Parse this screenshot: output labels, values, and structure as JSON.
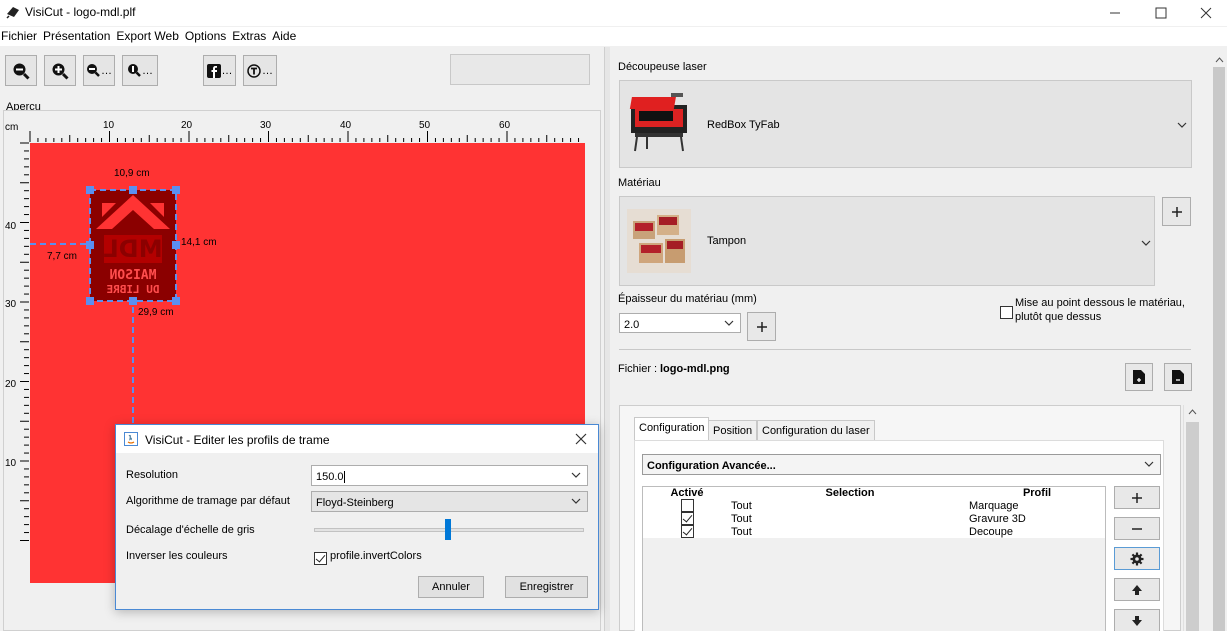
{
  "window": {
    "title": "VisiCut - logo-mdl.plf"
  },
  "menu": [
    "Fichier",
    "Présentation",
    "Export Web",
    "Options",
    "Extras",
    "Aide"
  ],
  "toolbar": {
    "more": "…"
  },
  "preview": {
    "label": "Aperçu",
    "unit": "cm",
    "top_ticks": [
      "10",
      "20",
      "30",
      "40",
      "50",
      "60"
    ],
    "left_ticks": [
      "40",
      "30",
      "20",
      "10"
    ],
    "width_label": "10,9 cm",
    "height_label": "14,1 cm",
    "left_label": "7,7 cm",
    "bottom_label": "29,9 cm",
    "logo_text_1": "MAISON",
    "logo_text_2": "DU LIBRE",
    "colors": {
      "bed": "#ff3333",
      "logo": "#8b0000",
      "handle": "#5b8ff0"
    }
  },
  "laser": {
    "label": "Découpeuse laser",
    "name": "RedBox TyFab"
  },
  "material": {
    "label": "Matériau",
    "name": "Tampon"
  },
  "thickness": {
    "label": "Épaisseur du matériau (mm)",
    "value": "2.0",
    "focus_line1": "Mise au point dessous le matériau,",
    "focus_line2": "plutôt que dessus"
  },
  "file": {
    "label": "Fichier :",
    "name": "logo-mdl.png"
  },
  "tabs": [
    "Configuration",
    "Position",
    "Configuration du laser"
  ],
  "config": {
    "selected": "Configuration Avancée...",
    "columns": [
      "Activé",
      "Selection",
      "Profil"
    ],
    "rows": [
      {
        "active": false,
        "selection": "Tout",
        "profile": "Marquage"
      },
      {
        "active": true,
        "selection": "Tout",
        "profile": "Gravure 3D"
      },
      {
        "active": true,
        "selection": "Tout",
        "profile": "Decoupe"
      }
    ]
  },
  "dialog": {
    "title": "VisiCut - Editer les profils de trame",
    "resolution_label": "Resolution",
    "resolution_value": "150.0",
    "algo_label": "Algorithme de tramage par défaut",
    "algo_value": "Floyd-Steinberg",
    "gray_label": "Décalage d'échelle de gris",
    "gray_value": 0.5,
    "invert_label": "Inverser les couleurs",
    "invert_checkbox": "profile.invertColors",
    "cancel": "Annuler",
    "save": "Enregistrer"
  }
}
